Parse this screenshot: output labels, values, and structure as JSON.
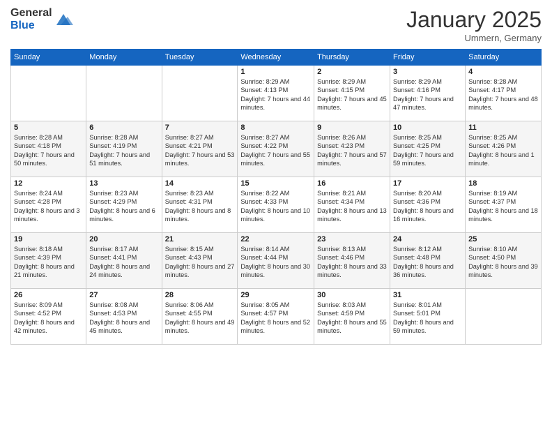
{
  "logo": {
    "general": "General",
    "blue": "Blue"
  },
  "header": {
    "month": "January 2025",
    "location": "Ummern, Germany"
  },
  "weekdays": [
    "Sunday",
    "Monday",
    "Tuesday",
    "Wednesday",
    "Thursday",
    "Friday",
    "Saturday"
  ],
  "weeks": [
    [
      {
        "day": "",
        "info": ""
      },
      {
        "day": "",
        "info": ""
      },
      {
        "day": "",
        "info": ""
      },
      {
        "day": "1",
        "info": "Sunrise: 8:29 AM\nSunset: 4:13 PM\nDaylight: 7 hours\nand 44 minutes."
      },
      {
        "day": "2",
        "info": "Sunrise: 8:29 AM\nSunset: 4:15 PM\nDaylight: 7 hours\nand 45 minutes."
      },
      {
        "day": "3",
        "info": "Sunrise: 8:29 AM\nSunset: 4:16 PM\nDaylight: 7 hours\nand 47 minutes."
      },
      {
        "day": "4",
        "info": "Sunrise: 8:28 AM\nSunset: 4:17 PM\nDaylight: 7 hours\nand 48 minutes."
      }
    ],
    [
      {
        "day": "5",
        "info": "Sunrise: 8:28 AM\nSunset: 4:18 PM\nDaylight: 7 hours\nand 50 minutes."
      },
      {
        "day": "6",
        "info": "Sunrise: 8:28 AM\nSunset: 4:19 PM\nDaylight: 7 hours\nand 51 minutes."
      },
      {
        "day": "7",
        "info": "Sunrise: 8:27 AM\nSunset: 4:21 PM\nDaylight: 7 hours\nand 53 minutes."
      },
      {
        "day": "8",
        "info": "Sunrise: 8:27 AM\nSunset: 4:22 PM\nDaylight: 7 hours\nand 55 minutes."
      },
      {
        "day": "9",
        "info": "Sunrise: 8:26 AM\nSunset: 4:23 PM\nDaylight: 7 hours\nand 57 minutes."
      },
      {
        "day": "10",
        "info": "Sunrise: 8:25 AM\nSunset: 4:25 PM\nDaylight: 7 hours\nand 59 minutes."
      },
      {
        "day": "11",
        "info": "Sunrise: 8:25 AM\nSunset: 4:26 PM\nDaylight: 8 hours\nand 1 minute."
      }
    ],
    [
      {
        "day": "12",
        "info": "Sunrise: 8:24 AM\nSunset: 4:28 PM\nDaylight: 8 hours\nand 3 minutes."
      },
      {
        "day": "13",
        "info": "Sunrise: 8:23 AM\nSunset: 4:29 PM\nDaylight: 8 hours\nand 6 minutes."
      },
      {
        "day": "14",
        "info": "Sunrise: 8:23 AM\nSunset: 4:31 PM\nDaylight: 8 hours\nand 8 minutes."
      },
      {
        "day": "15",
        "info": "Sunrise: 8:22 AM\nSunset: 4:33 PM\nDaylight: 8 hours\nand 10 minutes."
      },
      {
        "day": "16",
        "info": "Sunrise: 8:21 AM\nSunset: 4:34 PM\nDaylight: 8 hours\nand 13 minutes."
      },
      {
        "day": "17",
        "info": "Sunrise: 8:20 AM\nSunset: 4:36 PM\nDaylight: 8 hours\nand 16 minutes."
      },
      {
        "day": "18",
        "info": "Sunrise: 8:19 AM\nSunset: 4:37 PM\nDaylight: 8 hours\nand 18 minutes."
      }
    ],
    [
      {
        "day": "19",
        "info": "Sunrise: 8:18 AM\nSunset: 4:39 PM\nDaylight: 8 hours\nand 21 minutes."
      },
      {
        "day": "20",
        "info": "Sunrise: 8:17 AM\nSunset: 4:41 PM\nDaylight: 8 hours\nand 24 minutes."
      },
      {
        "day": "21",
        "info": "Sunrise: 8:15 AM\nSunset: 4:43 PM\nDaylight: 8 hours\nand 27 minutes."
      },
      {
        "day": "22",
        "info": "Sunrise: 8:14 AM\nSunset: 4:44 PM\nDaylight: 8 hours\nand 30 minutes."
      },
      {
        "day": "23",
        "info": "Sunrise: 8:13 AM\nSunset: 4:46 PM\nDaylight: 8 hours\nand 33 minutes."
      },
      {
        "day": "24",
        "info": "Sunrise: 8:12 AM\nSunset: 4:48 PM\nDaylight: 8 hours\nand 36 minutes."
      },
      {
        "day": "25",
        "info": "Sunrise: 8:10 AM\nSunset: 4:50 PM\nDaylight: 8 hours\nand 39 minutes."
      }
    ],
    [
      {
        "day": "26",
        "info": "Sunrise: 8:09 AM\nSunset: 4:52 PM\nDaylight: 8 hours\nand 42 minutes."
      },
      {
        "day": "27",
        "info": "Sunrise: 8:08 AM\nSunset: 4:53 PM\nDaylight: 8 hours\nand 45 minutes."
      },
      {
        "day": "28",
        "info": "Sunrise: 8:06 AM\nSunset: 4:55 PM\nDaylight: 8 hours\nand 49 minutes."
      },
      {
        "day": "29",
        "info": "Sunrise: 8:05 AM\nSunset: 4:57 PM\nDaylight: 8 hours\nand 52 minutes."
      },
      {
        "day": "30",
        "info": "Sunrise: 8:03 AM\nSunset: 4:59 PM\nDaylight: 8 hours\nand 55 minutes."
      },
      {
        "day": "31",
        "info": "Sunrise: 8:01 AM\nSunset: 5:01 PM\nDaylight: 8 hours\nand 59 minutes."
      },
      {
        "day": "",
        "info": ""
      }
    ]
  ]
}
